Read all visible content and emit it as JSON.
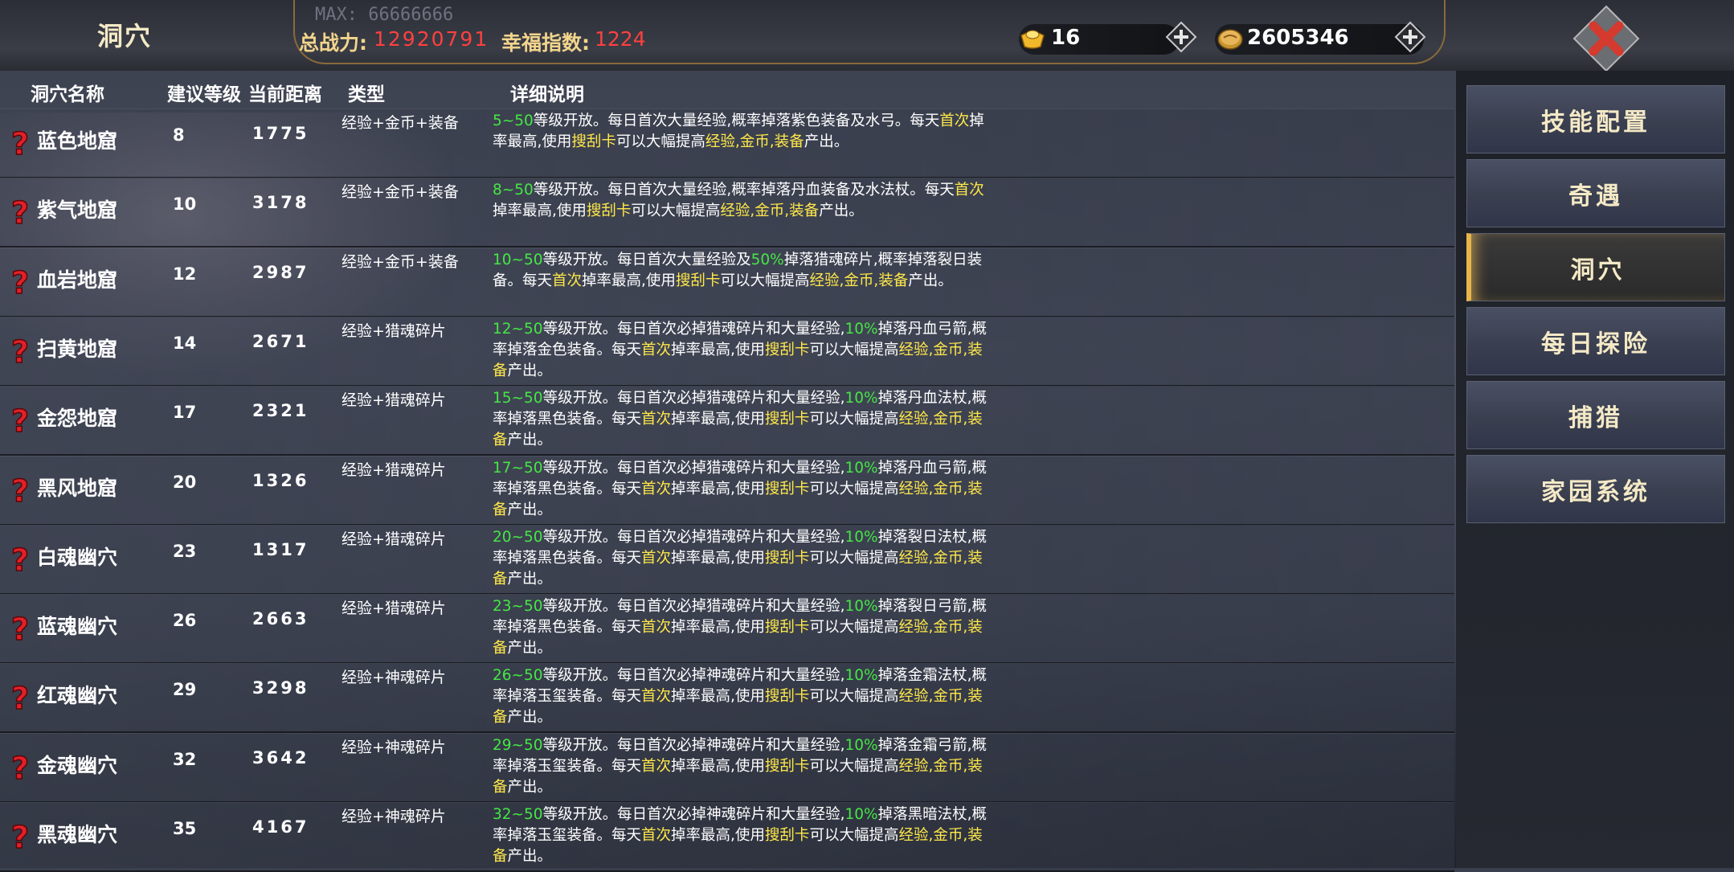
{
  "header": {
    "title": "洞穴",
    "max_label": "MAX: 66666666",
    "power_label": "总战力:",
    "power_value": "12920791",
    "happiness_label": "幸福指数:",
    "happiness_value": "1224",
    "gold_ingot_value": "16",
    "coin_value": "2605346"
  },
  "columns": {
    "name": "洞穴名称",
    "level": "建议等级",
    "distance": "当前距离",
    "type": "类型",
    "detail": "详细说明"
  },
  "rows": [
    {
      "name": "蓝色地窟",
      "level": "8",
      "distance": "1775",
      "type": "经验+金币+装备",
      "desc": [
        [
          "g",
          "5~50"
        ],
        [
          "w",
          "等级开放。每日首次大量经验,概率掉落紫色装备及水弓。每天"
        ],
        [
          "y",
          "首次"
        ],
        [
          "w",
          "掉率最高,使用"
        ],
        [
          "y",
          "搜刮卡"
        ],
        [
          "w",
          "可以大幅提高"
        ],
        [
          "y",
          "经验,金币,装备"
        ],
        [
          "w",
          "产出。"
        ]
      ]
    },
    {
      "name": "紫气地窟",
      "level": "10",
      "distance": "3178",
      "type": "经验+金币+装备",
      "desc": [
        [
          "g",
          "8~50"
        ],
        [
          "w",
          "等级开放。每日首次大量经验,概率掉落丹血装备及水法杖。每天"
        ],
        [
          "y",
          "首次"
        ],
        [
          "w",
          "掉率最高,使用"
        ],
        [
          "y",
          "搜刮卡"
        ],
        [
          "w",
          "可以大幅提高"
        ],
        [
          "y",
          "经验,金币,装备"
        ],
        [
          "w",
          "产出。"
        ]
      ]
    },
    {
      "name": "血岩地窟",
      "level": "12",
      "distance": "2987",
      "type": "经验+金币+装备",
      "desc": [
        [
          "g",
          "10~50"
        ],
        [
          "w",
          "等级开放。每日首次大量经验及"
        ],
        [
          "g",
          "50%"
        ],
        [
          "w",
          "掉落猎魂碎片,概率掉落裂日装备。每天"
        ],
        [
          "y",
          "首次"
        ],
        [
          "w",
          "掉率最高,使用"
        ],
        [
          "y",
          "搜刮卡"
        ],
        [
          "w",
          "可以大幅提高"
        ],
        [
          "y",
          "经验,金币,装备"
        ],
        [
          "w",
          "产出。"
        ]
      ]
    },
    {
      "name": "扫黄地窟",
      "level": "14",
      "distance": "2671",
      "type": "经验+猎魂碎片",
      "desc": [
        [
          "g",
          "12~50"
        ],
        [
          "w",
          "等级开放。每日首次必掉猎魂碎片和大量经验,"
        ],
        [
          "g",
          "10%"
        ],
        [
          "w",
          "掉落丹血弓箭,概率掉落金色装备。每天"
        ],
        [
          "y",
          "首次"
        ],
        [
          "w",
          "掉率最高,使用"
        ],
        [
          "y",
          "搜刮卡"
        ],
        [
          "w",
          "可以大幅提高"
        ],
        [
          "y",
          "经验,金币,装备"
        ],
        [
          "w",
          "产出。"
        ]
      ]
    },
    {
      "name": "金怨地窟",
      "level": "17",
      "distance": "2321",
      "type": "经验+猎魂碎片",
      "desc": [
        [
          "g",
          "15~50"
        ],
        [
          "w",
          "等级开放。每日首次必掉猎魂碎片和大量经验,"
        ],
        [
          "g",
          "10%"
        ],
        [
          "w",
          "掉落丹血法杖,概率掉落黑色装备。每天"
        ],
        [
          "y",
          "首次"
        ],
        [
          "w",
          "掉率最高,使用"
        ],
        [
          "y",
          "搜刮卡"
        ],
        [
          "w",
          "可以大幅提高"
        ],
        [
          "y",
          "经验,金币,装备"
        ],
        [
          "w",
          "产出。"
        ]
      ]
    },
    {
      "name": "黑风地窟",
      "level": "20",
      "distance": "1326",
      "type": "经验+猎魂碎片",
      "desc": [
        [
          "g",
          "17~50"
        ],
        [
          "w",
          "等级开放。每日首次必掉猎魂碎片和大量经验,"
        ],
        [
          "g",
          "10%"
        ],
        [
          "w",
          "掉落丹血弓箭,概率掉落黑色装备。每天"
        ],
        [
          "y",
          "首次"
        ],
        [
          "w",
          "掉率最高,使用"
        ],
        [
          "y",
          "搜刮卡"
        ],
        [
          "w",
          "可以大幅提高"
        ],
        [
          "y",
          "经验,金币,装备"
        ],
        [
          "w",
          "产出。"
        ]
      ]
    },
    {
      "name": "白魂幽穴",
      "level": "23",
      "distance": "1317",
      "type": "经验+猎魂碎片",
      "desc": [
        [
          "g",
          "20~50"
        ],
        [
          "w",
          "等级开放。每日首次必掉猎魂碎片和大量经验,"
        ],
        [
          "g",
          "10%"
        ],
        [
          "w",
          "掉落裂日法杖,概率掉落黑色装备。每天"
        ],
        [
          "y",
          "首次"
        ],
        [
          "w",
          "掉率最高,使用"
        ],
        [
          "y",
          "搜刮卡"
        ],
        [
          "w",
          "可以大幅提高"
        ],
        [
          "y",
          "经验,金币,装备"
        ],
        [
          "w",
          "产出。"
        ]
      ]
    },
    {
      "name": "蓝魂幽穴",
      "level": "26",
      "distance": "2663",
      "type": "经验+猎魂碎片",
      "desc": [
        [
          "g",
          "23~50"
        ],
        [
          "w",
          "等级开放。每日首次必掉猎魂碎片和大量经验,"
        ],
        [
          "g",
          "10%"
        ],
        [
          "w",
          "掉落裂日弓箭,概率掉落黑色装备。每天"
        ],
        [
          "y",
          "首次"
        ],
        [
          "w",
          "掉率最高,使用"
        ],
        [
          "y",
          "搜刮卡"
        ],
        [
          "w",
          "可以大幅提高"
        ],
        [
          "y",
          "经验,金币,装备"
        ],
        [
          "w",
          "产出。"
        ]
      ]
    },
    {
      "name": "红魂幽穴",
      "level": "29",
      "distance": "3298",
      "type": "经验+神魂碎片",
      "desc": [
        [
          "g",
          "26~50"
        ],
        [
          "w",
          "等级开放。每日首次必掉神魂碎片和大量经验,"
        ],
        [
          "g",
          "10%"
        ],
        [
          "w",
          "掉落金霜法杖,概率掉落玉玺装备。每天"
        ],
        [
          "y",
          "首次"
        ],
        [
          "w",
          "掉率最高,使用"
        ],
        [
          "y",
          "搜刮卡"
        ],
        [
          "w",
          "可以大幅提高"
        ],
        [
          "y",
          "经验,金币,装备"
        ],
        [
          "w",
          "产出。"
        ]
      ]
    },
    {
      "name": "金魂幽穴",
      "level": "32",
      "distance": "3642",
      "type": "经验+神魂碎片",
      "desc": [
        [
          "g",
          "29~50"
        ],
        [
          "w",
          "等级开放。每日首次必掉神魂碎片和大量经验,"
        ],
        [
          "g",
          "10%"
        ],
        [
          "w",
          "掉落金霜弓箭,概率掉落玉玺装备。每天"
        ],
        [
          "y",
          "首次"
        ],
        [
          "w",
          "掉率最高,使用"
        ],
        [
          "y",
          "搜刮卡"
        ],
        [
          "w",
          "可以大幅提高"
        ],
        [
          "y",
          "经验,金币,装备"
        ],
        [
          "w",
          "产出。"
        ]
      ]
    },
    {
      "name": "黑魂幽穴",
      "level": "35",
      "distance": "4167",
      "type": "经验+神魂碎片",
      "desc": [
        [
          "g",
          "32~50"
        ],
        [
          "w",
          "等级开放。每日首次必掉神魂碎片和大量经验,"
        ],
        [
          "g",
          "10%"
        ],
        [
          "w",
          "掉落黑暗法杖,概率掉落玉玺装备。每天"
        ],
        [
          "y",
          "首次"
        ],
        [
          "w",
          "掉率最高,使用"
        ],
        [
          "y",
          "搜刮卡"
        ],
        [
          "w",
          "可以大幅提高"
        ],
        [
          "y",
          "经验,金币,装备"
        ],
        [
          "w",
          "产出。"
        ]
      ]
    }
  ],
  "menu": [
    {
      "label": "技能配置",
      "active": false
    },
    {
      "label": "奇遇",
      "active": false
    },
    {
      "label": "洞穴",
      "active": true
    },
    {
      "label": "每日探险",
      "active": false
    },
    {
      "label": "捕猎",
      "active": false
    },
    {
      "label": "家园系统",
      "active": false
    }
  ],
  "colors": {
    "highlight_green": "#45e645",
    "highlight_yellow": "#ffe84a",
    "stat_red": "#ff4040",
    "title_gold": "#f4e9c6"
  },
  "icons": {
    "unknown": "question-mark-icon",
    "gold": "gold-ingot-icon",
    "coin": "coin-icon",
    "add": "plus-icon",
    "close": "close-icon"
  }
}
